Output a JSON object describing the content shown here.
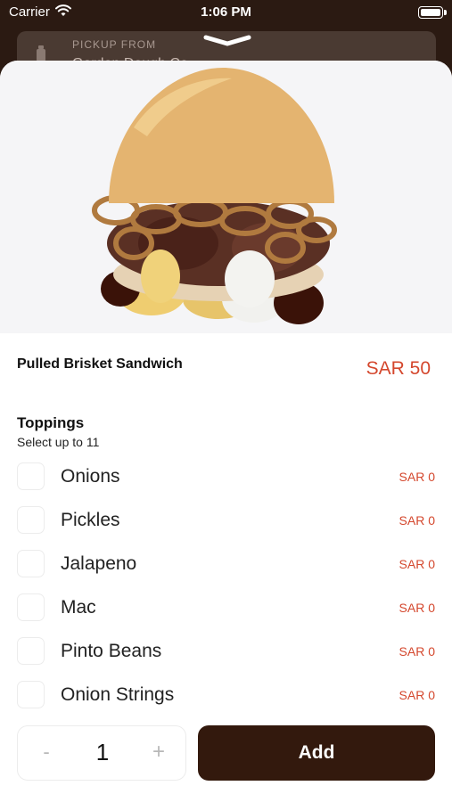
{
  "status_bar": {
    "carrier": "Carrier",
    "time": "1:06 PM"
  },
  "pickup": {
    "label": "PICKUP FROM",
    "value": "Garden Dough Co."
  },
  "product": {
    "name": "Pulled Brisket Sandwich",
    "price": "SAR 50",
    "image": "pulled-brisket-sandwich-photo"
  },
  "toppings": {
    "title": "Toppings",
    "subtitle": "Select up to 11",
    "options": [
      {
        "label": "Onions",
        "price": "SAR 0",
        "checked": false
      },
      {
        "label": "Pickles",
        "price": "SAR 0",
        "checked": false
      },
      {
        "label": "Jalapeno",
        "price": "SAR 0",
        "checked": false
      },
      {
        "label": "Mac",
        "price": "SAR 0",
        "checked": false
      },
      {
        "label": "Pinto Beans",
        "price": "SAR 0",
        "checked": false
      },
      {
        "label": "Onion Strings",
        "price": "SAR 0",
        "checked": false
      }
    ]
  },
  "footer": {
    "minus_label": "-",
    "quantity": "1",
    "plus_label": "+",
    "add_label": "Add"
  },
  "colors": {
    "brand_dark": "#33190d",
    "price_accent": "#d4472d",
    "status_bar_bg": "#2b1a12"
  }
}
